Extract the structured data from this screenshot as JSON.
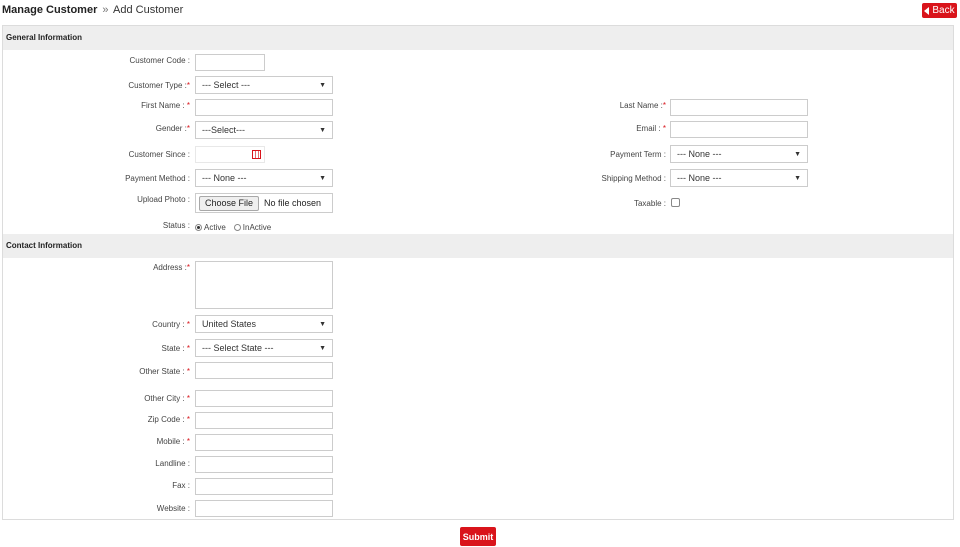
{
  "breadcrumb": {
    "parent": "Manage Customer",
    "separator": "»",
    "current": "Add Customer"
  },
  "header": {
    "back_label": "Back"
  },
  "general": {
    "title": "General Information",
    "customer_code_label": "Customer Code :",
    "customer_type_label": "Customer Type :",
    "customer_type_value": "--- Select ---",
    "first_name_label": "First Name :",
    "last_name_label": "Last Name :",
    "gender_label": "Gender :",
    "gender_value": "---Select---",
    "email_label": "Email :",
    "customer_since_label": "Customer Since :",
    "payment_term_label": "Payment Term :",
    "payment_term_value": "--- None ---",
    "payment_method_label": "Payment Method :",
    "payment_method_value": "--- None ---",
    "shipping_method_label": "Shipping Method :",
    "shipping_method_value": "--- None ---",
    "upload_photo_label": "Upload Photo :",
    "choose_file_label": "Choose File",
    "no_file_text": "No file chosen",
    "taxable_label": "Taxable :",
    "status_label": "Status :",
    "status_active": "Active",
    "status_inactive": "InActive"
  },
  "contact": {
    "title": "Contact Information",
    "address_label": "Address :",
    "country_label": "Country :",
    "country_value": "United States",
    "state_label": "State :",
    "state_value": "--- Select State ---",
    "other_state_label": "Other State :",
    "other_city_label": "Other City :",
    "zip_label": "Zip Code :",
    "mobile_label": "Mobile :",
    "landline_label": "Landline :",
    "fax_label": "Fax :",
    "website_label": "Website :"
  },
  "footer": {
    "submit_label": "Submit"
  },
  "colors": {
    "accent": "#d9141b",
    "section_bg": "#eeeeee",
    "border": "#cccccc"
  }
}
